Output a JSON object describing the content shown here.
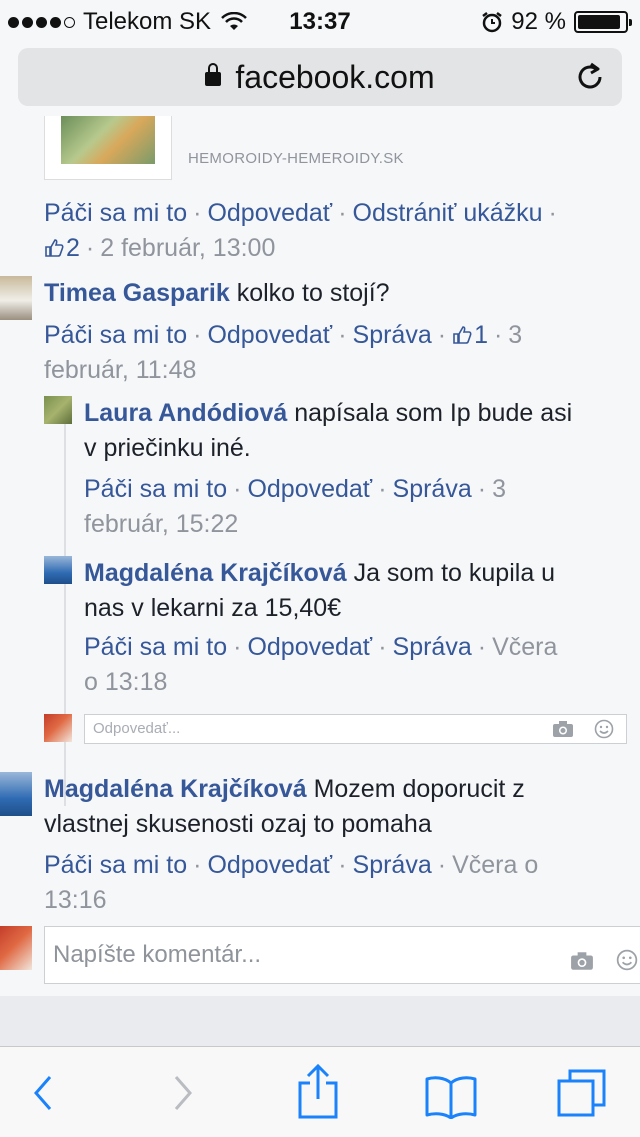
{
  "status": {
    "carrier": "Telekom SK",
    "time": "13:37",
    "battery": "92 %",
    "battery_level": 0.92
  },
  "browser": {
    "url": "facebook.com"
  },
  "preview": {
    "domain": "HEMOROIDY-HEMEROIDY.SK"
  },
  "top_actions": {
    "like": "Páči sa mi to",
    "reply": "Odpovedať",
    "remove": "Odstrániť ukážku",
    "likes": "2",
    "time": "2 február, 13:00"
  },
  "comments": [
    {
      "author": "Timea Gasparik",
      "text": "kolko to stojí?",
      "like": "Páči sa mi to",
      "reply": "Odpovedať",
      "message": "Správa",
      "likes": "1",
      "time_a": "3",
      "time_b": "február, 11:48"
    },
    {
      "author": "Laura Andódiová",
      "text_a": "napísala som Ip bude asi",
      "text_b": "v priečinku iné.",
      "like": "Páči sa mi to",
      "reply": "Odpovedať",
      "message": "Správa",
      "time_a": "3",
      "time_b": "február, 15:22"
    },
    {
      "author": "Magdaléna Krajčíková",
      "text_a": "Ja som to kupila u",
      "text_b": "nas v lekarni za 15,40€",
      "like": "Páči sa mi to",
      "reply": "Odpovedať",
      "message": "Správa",
      "time_a": "Včera",
      "time_b": "o 13:18"
    },
    {
      "author": "Magdaléna Krajčíková",
      "text_a": "Mozem doporucit z",
      "text_b": "vlastnej skusenosti ozaj to pomaha",
      "like": "Páči sa mi to",
      "reply": "Odpovedať",
      "message": "Správa",
      "time_a": "Včera o",
      "time_b": "13:16"
    }
  ],
  "reply_placeholder": "Odpovedať...",
  "comment_placeholder": "Napíšte komentár...",
  "colors": {
    "link": "#365899",
    "meta": "#90949c",
    "ios_blue": "#1a82fb"
  },
  "toolbar": {
    "icons": [
      "back-icon",
      "forward-icon",
      "share-icon",
      "bookmarks-icon",
      "tabs-icon"
    ]
  }
}
